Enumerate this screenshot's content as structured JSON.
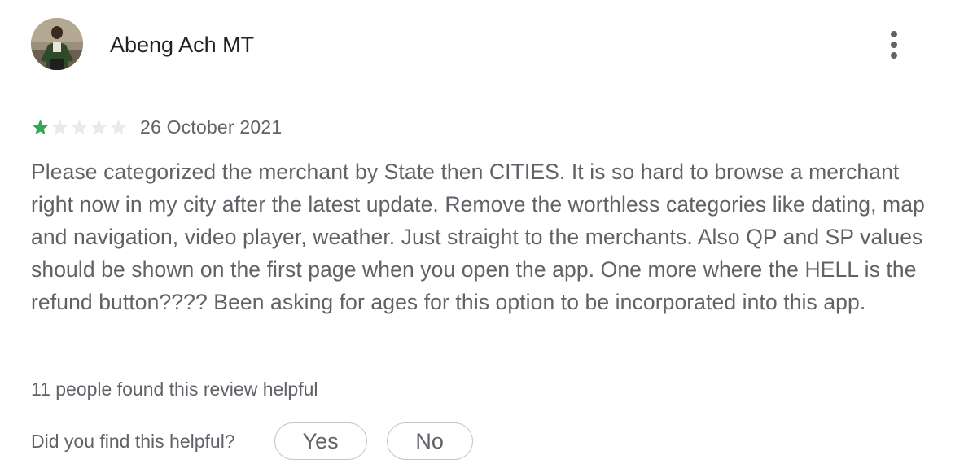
{
  "author": {
    "name": "Abeng Ach MT",
    "avatar_icon": "user-photo"
  },
  "menu": {
    "icon": "more-vert-icon"
  },
  "rating": {
    "value": 1,
    "max": 5,
    "filled_color": "#34a853",
    "empty_color": "#e8eaed",
    "date": "26 October 2021"
  },
  "review": {
    "text": "Please categorized the merchant by State then CITIES. It is so hard to browse a merchant right now in my city after the latest update. Remove the worthless categories like dating, map and navigation, video player, weather. Just straight to the merchants. Also QP and SP values should be shown on the first page when you open the app. One more where the HELL is the refund button???? Been asking for ages for this option to be incorporated into this app."
  },
  "helpful": {
    "count_text": "11 people found this review helpful",
    "question": "Did you find this helpful?",
    "yes_label": "Yes",
    "no_label": "No"
  }
}
